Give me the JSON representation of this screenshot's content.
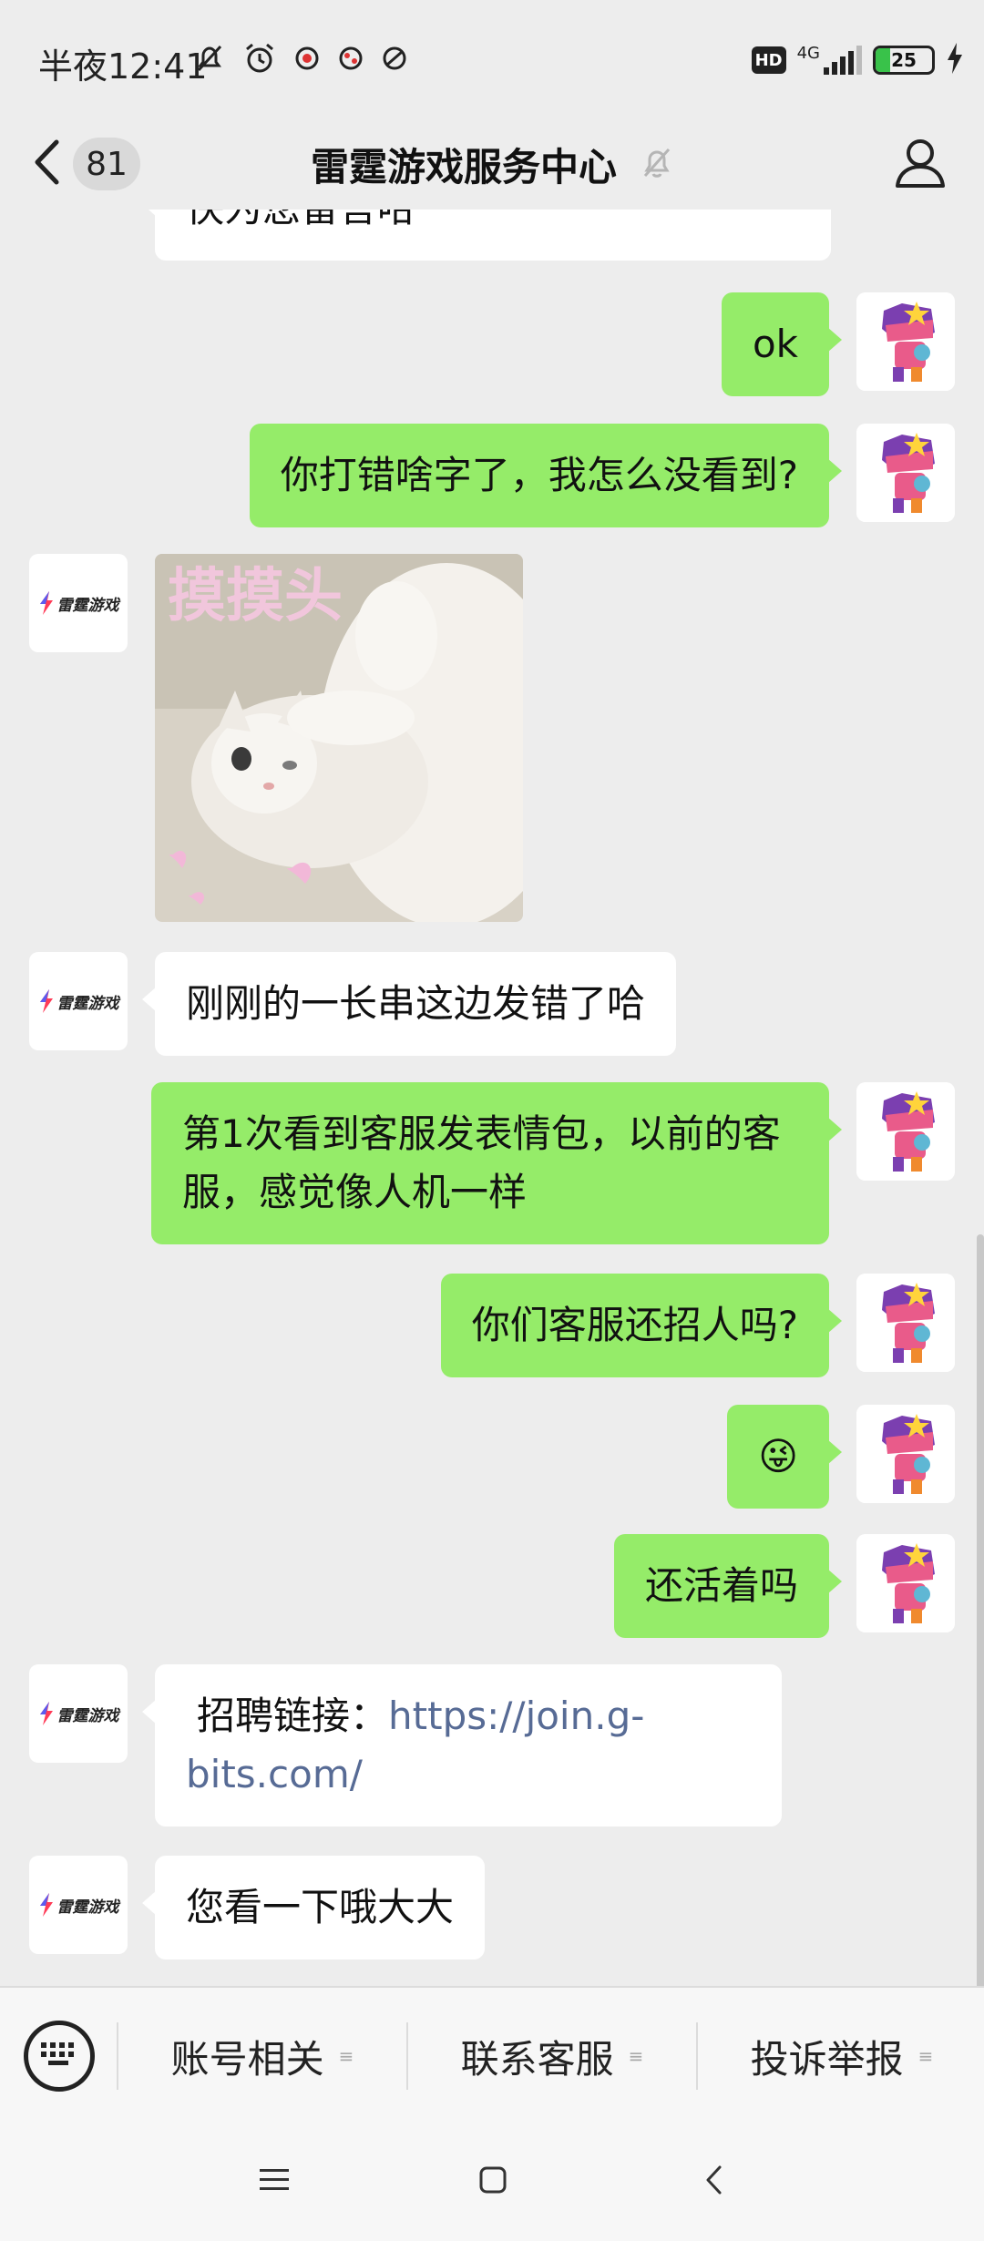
{
  "status_bar": {
    "time": "半夜12:41",
    "hd": "HD",
    "network": "4G",
    "battery_level": "25",
    "battery_fraction": 0.25,
    "battery_color": "#39c24a"
  },
  "header": {
    "unread_count": "81",
    "title": "雷霆游戏服务中心"
  },
  "brand": {
    "logo_text": "雷霆游戏",
    "logo_color": "#5b5bf0",
    "accent_color": "#ff3b57"
  },
  "messages": [
    {
      "side": "in",
      "text": "快为您留言哈"
    },
    {
      "side": "out",
      "text": "ok"
    },
    {
      "side": "out",
      "text": "你打错啥字了，我怎么没看到?"
    },
    {
      "side": "in",
      "type": "sticker",
      "caption": "摸摸头"
    },
    {
      "side": "in",
      "text": "刚刚的一长串这边发错了哈"
    },
    {
      "side": "out",
      "text": "第1次看到客服发表情包，以前的客服，感觉像人机一样"
    },
    {
      "side": "out",
      "text": "你们客服还招人吗?"
    },
    {
      "side": "out",
      "type": "emoji",
      "text": "😜"
    },
    {
      "side": "out",
      "text": "还活着吗"
    },
    {
      "side": "in",
      "prefix": "招聘链接：",
      "link": "https://join.g-bits.com/"
    },
    {
      "side": "in",
      "text": "您看一下哦大大"
    }
  ],
  "bubble_colors": {
    "incoming": "#ffffff",
    "outgoing": "#95ec69",
    "link": "#576b95"
  },
  "menu": {
    "items": [
      {
        "label": "账号相关"
      },
      {
        "label": "联系客服"
      },
      {
        "label": "投诉举报"
      }
    ]
  },
  "icons": {
    "back": "chevron-left-icon",
    "mute": "bell-off-icon",
    "profile": "person-icon",
    "keyboard": "keyboard-icon",
    "menu_glyph": "≡"
  }
}
